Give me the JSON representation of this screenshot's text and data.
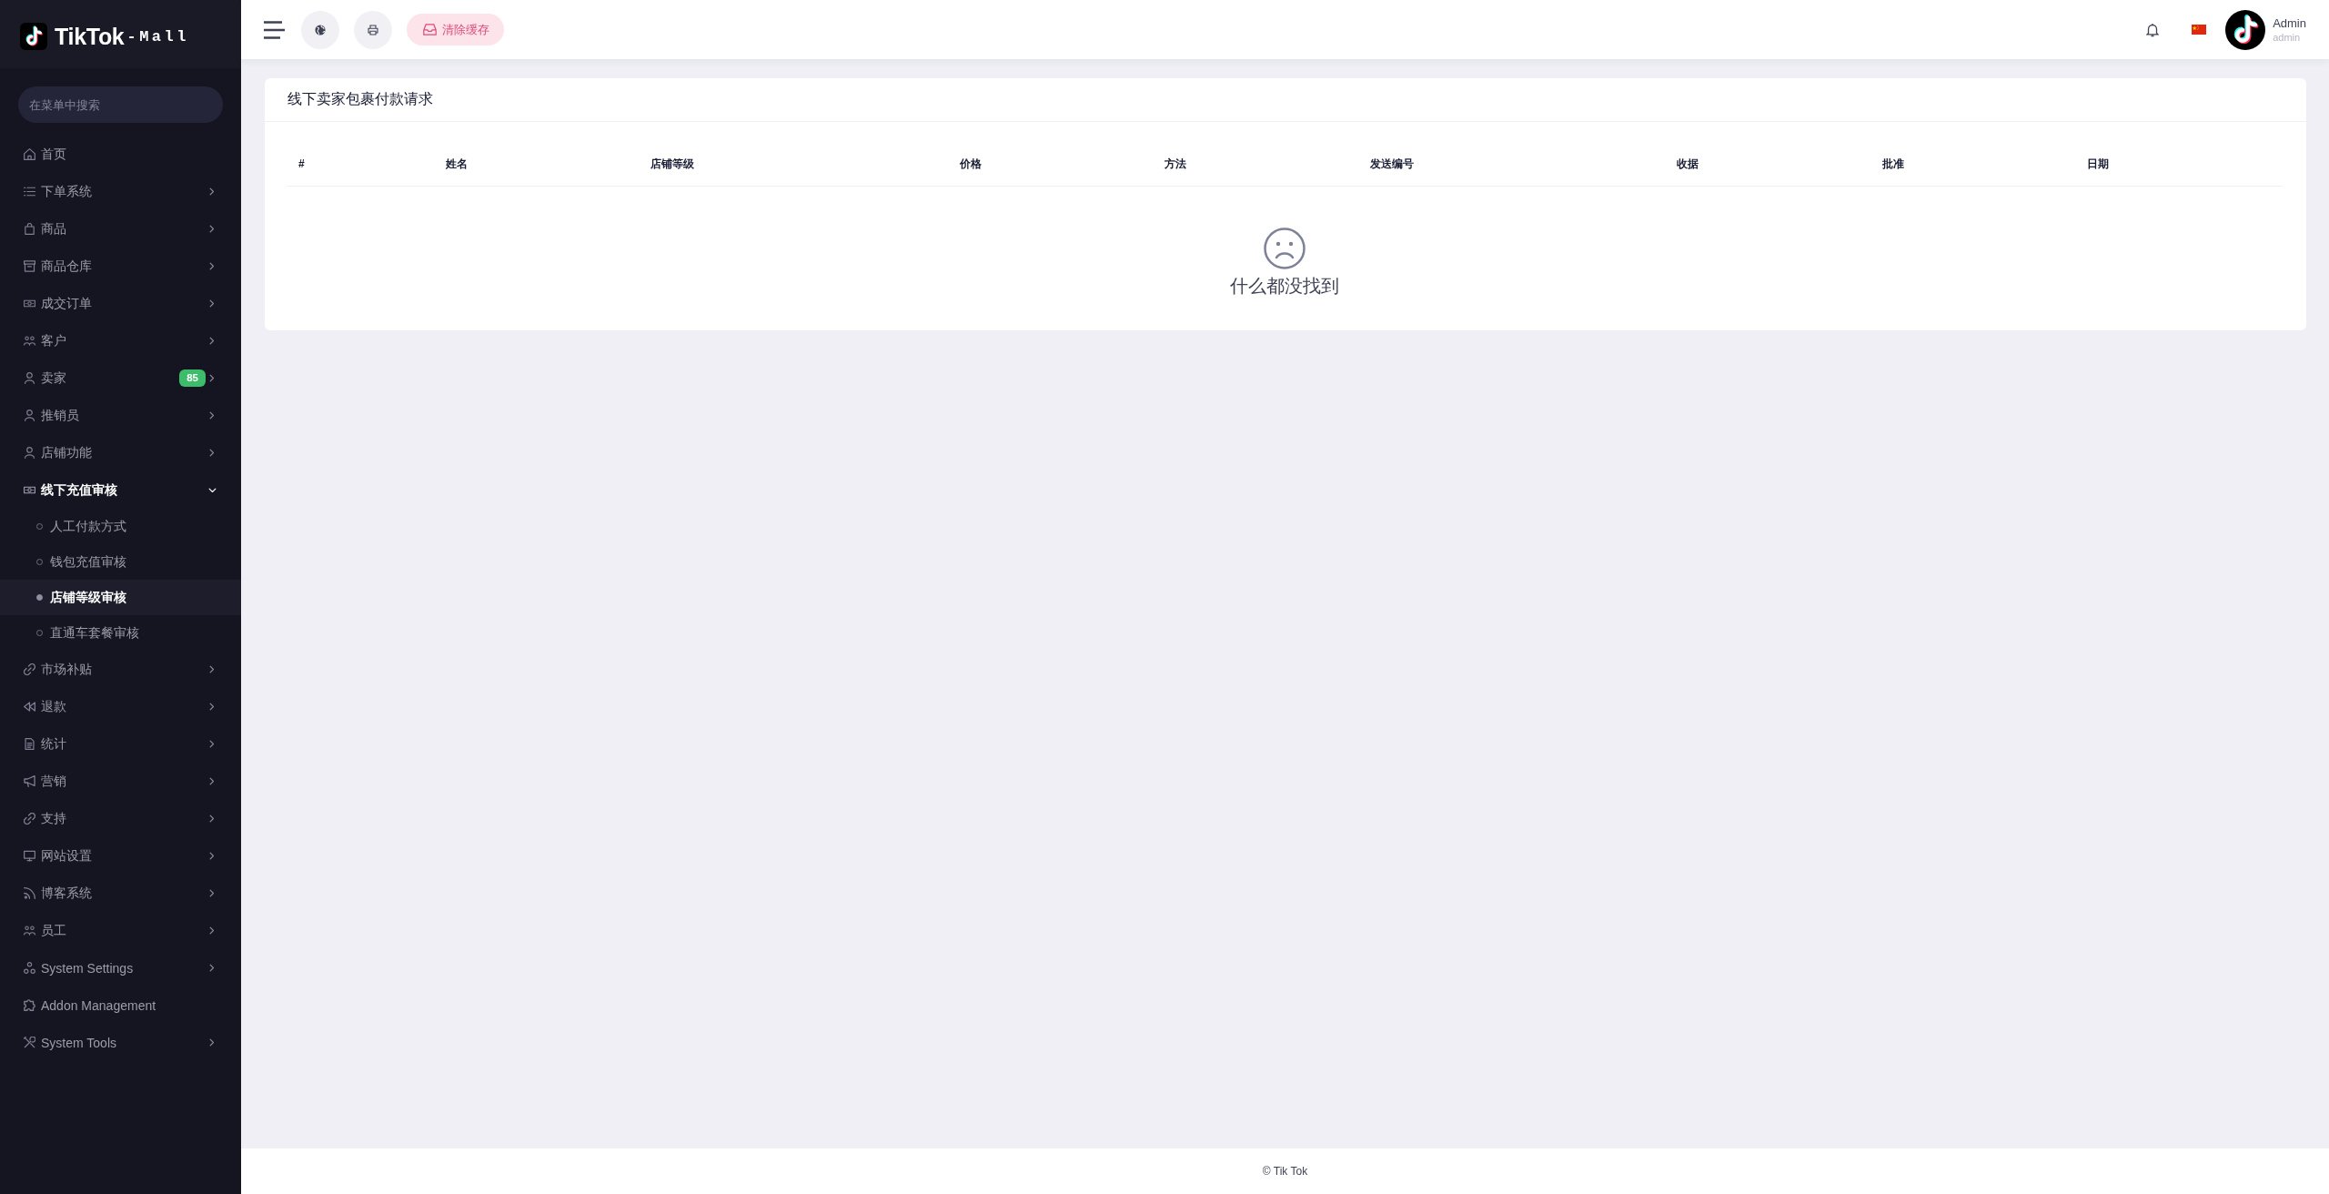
{
  "sidebar": {
    "logo": {
      "brand": "TikTok",
      "suffix": "-Mall"
    },
    "search": {
      "placeholder": "在菜单中搜索"
    },
    "menu": [
      {
        "label": "首页",
        "kind": "link",
        "expanded": false
      },
      {
        "label": "下单系统",
        "kind": "group",
        "expanded": false
      },
      {
        "label": "商品",
        "kind": "group",
        "expanded": false
      },
      {
        "label": "商品仓库",
        "kind": "group",
        "expanded": false
      },
      {
        "label": "成交订单",
        "kind": "group",
        "expanded": false
      },
      {
        "label": "客户",
        "kind": "group",
        "expanded": false
      },
      {
        "label": "卖家",
        "kind": "group",
        "expanded": false,
        "badge": "85"
      },
      {
        "label": "推销员",
        "kind": "group",
        "expanded": false
      },
      {
        "label": "店铺功能",
        "kind": "group",
        "expanded": false
      },
      {
        "label": "线下充值审核",
        "kind": "group",
        "expanded": true,
        "children": [
          {
            "label": "人工付款方式",
            "selected": false
          },
          {
            "label": "钱包充值审核",
            "selected": false
          },
          {
            "label": "店铺等级审核",
            "selected": true
          },
          {
            "label": "直通车套餐审核",
            "selected": false
          }
        ]
      },
      {
        "label": "市场补贴",
        "kind": "group",
        "expanded": false
      },
      {
        "label": "退款",
        "kind": "group",
        "expanded": false
      },
      {
        "label": "统计",
        "kind": "group",
        "expanded": false
      },
      {
        "label": "营销",
        "kind": "group",
        "expanded": false
      },
      {
        "label": "支持",
        "kind": "group",
        "expanded": false
      },
      {
        "label": "网站设置",
        "kind": "group",
        "expanded": false
      },
      {
        "label": "博客系统",
        "kind": "group",
        "expanded": false
      },
      {
        "label": "员工",
        "kind": "group",
        "expanded": false
      },
      {
        "label": "System Settings",
        "kind": "group",
        "expanded": false
      },
      {
        "label": "Addon Management",
        "kind": "link",
        "expanded": false
      },
      {
        "label": "System Tools",
        "kind": "group",
        "expanded": false
      }
    ]
  },
  "topbar": {
    "clear_cache_button": "清除缓存",
    "user": {
      "name": "Admin",
      "role": "admin"
    }
  },
  "card": {
    "title": "线下卖家包裹付款请求",
    "table": {
      "columns": [
        "#",
        "姓名",
        "店铺等级",
        "价格",
        "方法",
        "发送编号",
        "收据",
        "批准",
        "日期"
      ],
      "empty_message": "什么都没找到"
    }
  },
  "footer": "© Tik Tok"
}
